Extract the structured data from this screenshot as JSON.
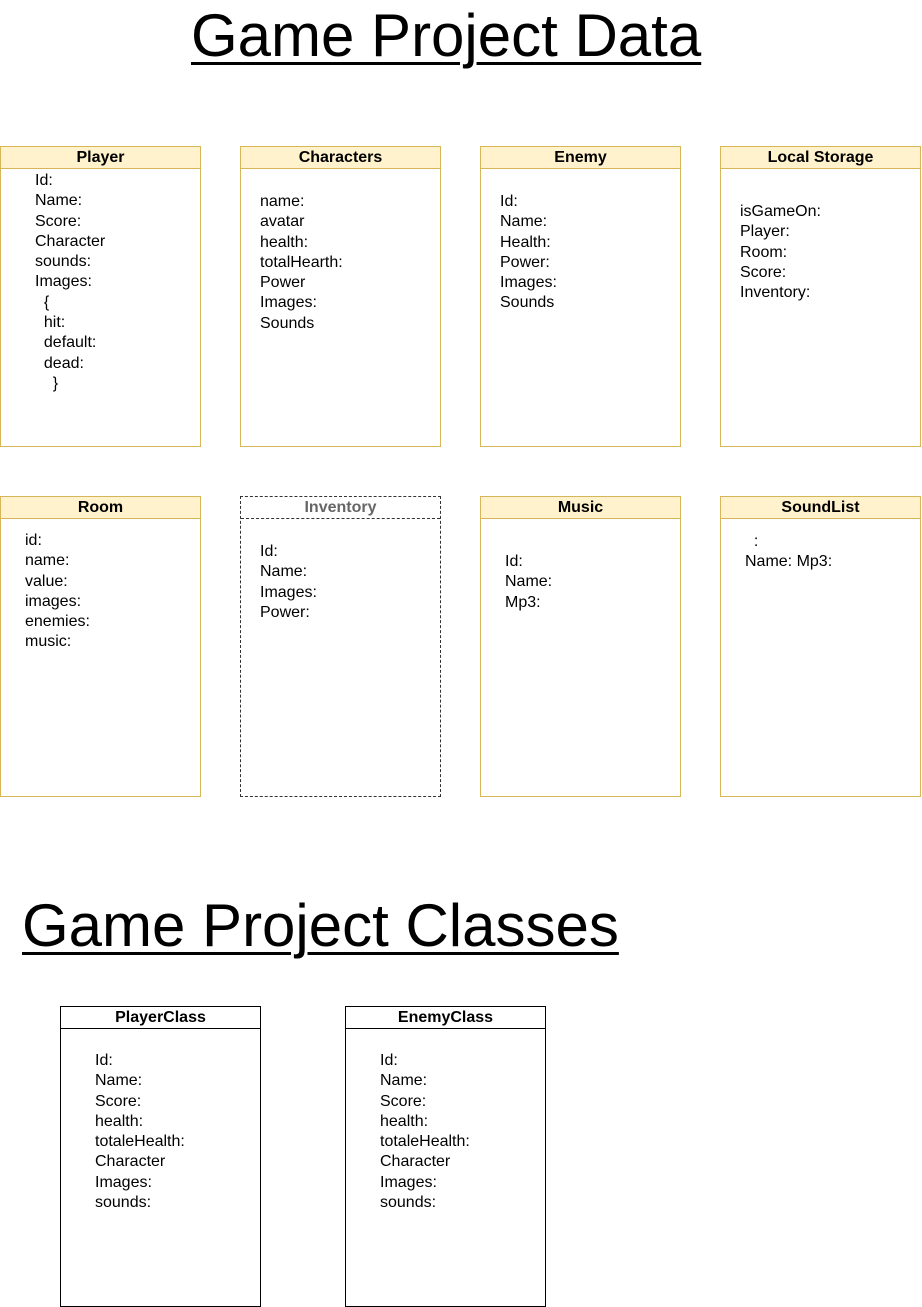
{
  "headings": {
    "data": "Game Project Data",
    "classes": "Game Project Classes"
  },
  "boxes": {
    "player": {
      "title": "Player",
      "fields": [
        "Id:",
        "Name:",
        "Score:",
        "Character",
        "sounds:",
        "Images:",
        "  {",
        "  hit:",
        "  default:",
        "  dead:",
        "    }"
      ]
    },
    "characters": {
      "title": "Characters",
      "fields": [
        "name:",
        "avatar",
        "health:",
        "totalHearth:",
        "Power",
        "Images:",
        "Sounds"
      ]
    },
    "enemy": {
      "title": "Enemy",
      "fields": [
        "Id:",
        "Name:",
        "Health:",
        "Power:",
        "Images:",
        "Sounds"
      ]
    },
    "local_storage": {
      "title": "Local Storage",
      "fields": [
        "isGameOn:",
        "Player:",
        "Room:",
        "Score:",
        "Inventory:"
      ]
    },
    "room": {
      "title": "Room",
      "fields": [
        "id:",
        "name:",
        "value:",
        "images:",
        "enemies:",
        "music:"
      ]
    },
    "inventory": {
      "title": "Inventory",
      "fields": [
        "Id:",
        "Name:",
        "Images:",
        "Power:"
      ]
    },
    "music": {
      "title": "Music",
      "fields": [
        "Id:",
        "Name:",
        "Mp3:"
      ]
    },
    "soundlist": {
      "title": "SoundList",
      "fields": [
        "  :",
        "Name: Mp3:"
      ]
    },
    "player_class": {
      "title": "PlayerClass",
      "fields": [
        "Id:",
        "Name:",
        "Score:",
        "health:",
        "totaleHealth:",
        "Character",
        "Images:",
        "sounds:"
      ]
    },
    "enemy_class": {
      "title": "EnemyClass",
      "fields": [
        "Id:",
        "Name:",
        "Score:",
        "health:",
        "totaleHealth:",
        "Character",
        "Images:",
        "sounds:"
      ]
    }
  },
  "colors": {
    "box_header_fill": "#fff2cc",
    "box_border": "#d6b656",
    "dashed_border": "#333333",
    "class_border": "#000000"
  }
}
